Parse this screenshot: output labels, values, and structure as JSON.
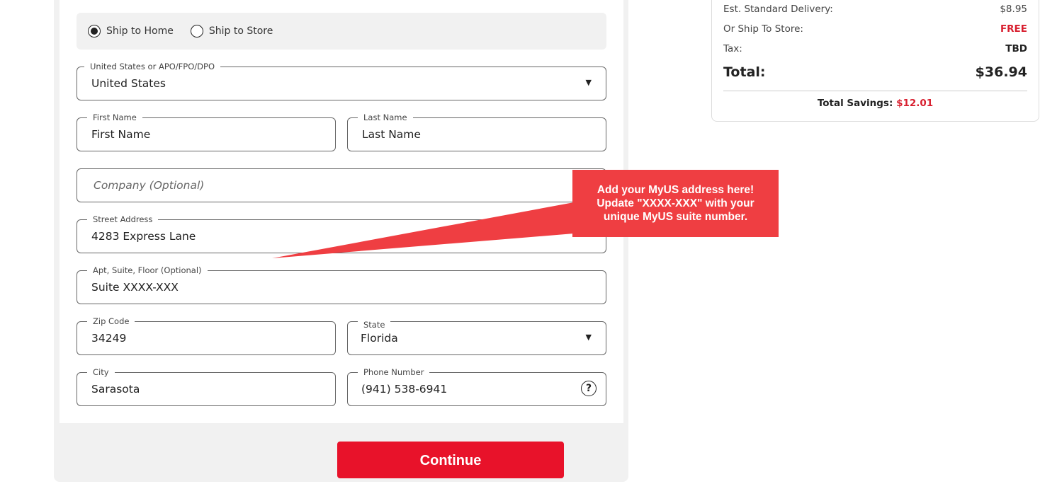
{
  "shipping_options": {
    "home_label": "Ship to Home",
    "home_selected": true,
    "store_label": "Ship to Store",
    "store_selected": false
  },
  "form": {
    "country": {
      "label": "United States or APO/FPO/DPO",
      "value": "United States"
    },
    "first_name": {
      "label": "First Name",
      "placeholder": "First Name"
    },
    "last_name": {
      "label": "Last Name",
      "placeholder": "Last Name"
    },
    "company": {
      "placeholder": "Company (Optional)"
    },
    "street": {
      "label": "Street Address",
      "value": "4283 Express Lane"
    },
    "apt": {
      "label": "Apt, Suite, Floor (Optional)",
      "value": "Suite XXXX-XXX"
    },
    "zip": {
      "label": "Zip Code",
      "value": "34249"
    },
    "state": {
      "label": "State",
      "value": "Florida"
    },
    "city": {
      "label": "City",
      "value": "Sarasota"
    },
    "phone": {
      "label": "Phone Number",
      "value": "(941) 538-6941",
      "help_glyph": "?"
    }
  },
  "continue_label": "Continue",
  "summary": {
    "delivery_label": "Est. Standard Delivery:",
    "delivery_value": "$8.95",
    "store_label": "Or Ship To Store:",
    "store_value": "FREE",
    "tax_label": "Tax:",
    "tax_value": "TBD",
    "total_label": "Total:",
    "total_value": "$36.94",
    "savings_label": "Total Savings:",
    "savings_value": "$12.01"
  },
  "callout": {
    "line1": "Add your MyUS address here!",
    "line2": "Update \"XXXX-XXX\" with your",
    "line3": "unique MyUS suite number."
  },
  "colors": {
    "accent_red": "#e8122a",
    "callout_red": "#ef3e42",
    "price_red": "#d81f2f"
  },
  "icons": {
    "dropdown": "triangle-down",
    "help": "question-circle"
  }
}
